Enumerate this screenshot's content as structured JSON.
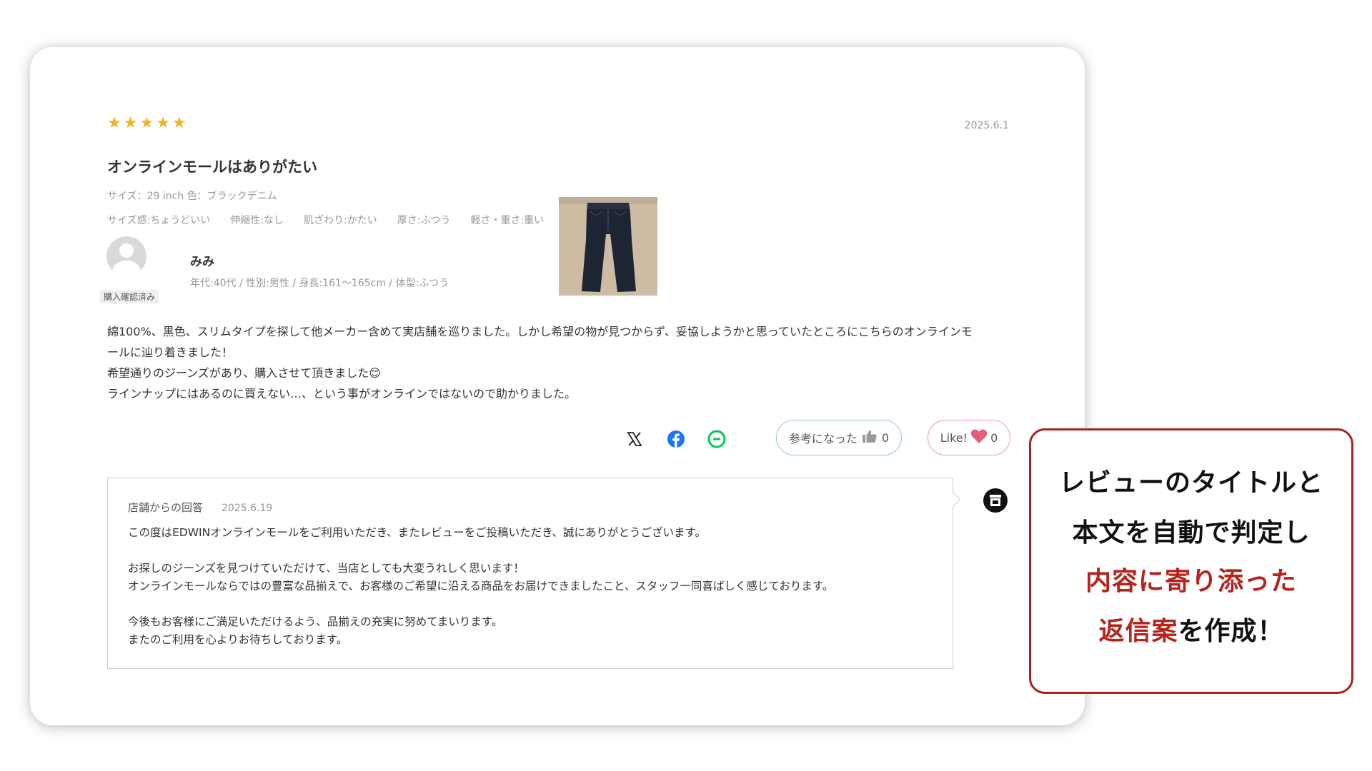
{
  "review": {
    "rating": 5,
    "date": "2025.6.1",
    "title": "オンラインモールはありがたい",
    "meta": "サイズ：29 inch 色：ブラックデニム",
    "attributes": [
      "サイズ感:ちょうどいい",
      "伸縮性:なし",
      "肌ざわり:かたい",
      "厚さ:ふつう",
      "軽さ・重さ:重い"
    ],
    "reviewer": {
      "name": "みみ",
      "info": "年代:40代 / 性別:男性 / 身長:161〜165cm / 体型:ふつう",
      "badge": "購入確認済み"
    },
    "body": [
      "綿100%、黒色、スリムタイプを探して他メーカー含めて実店舗を巡りました。しかし希望の物が見つからず、妥協しようかと思っていたところにこちらのオンラインモ",
      "ールに辿り着きました！",
      "希望通りのジーンズがあり、購入させて頂きました😊",
      "ラインナップにはあるのに買えない…、という事がオンラインではないので助かりました。"
    ],
    "share_icons": [
      "x-icon",
      "facebook-icon",
      "line-icon"
    ],
    "helpful": {
      "label": "参考になった",
      "count": "0"
    },
    "like": {
      "label": "Like!",
      "count": "0"
    }
  },
  "reply": {
    "label": "店舗からの回答",
    "date": "2025.6.19",
    "paragraphs": [
      [
        "この度はEDWINオンラインモールをご利用いただき、またレビューをご投稿いただき、誠にありがとうございます。"
      ],
      [
        "お探しのジーンズを見つけていただけて、当店としても大変うれしく思います！",
        "オンラインモールならではの豊富な品揃えで、お客様のご希望に沿える商品をお届けできましたこと、スタッフ一同喜ばしく感じております。"
      ],
      [
        "今後もお客様にご満足いただけるよう、品揃えの充実に努めてまいります。",
        "またのご利用を心よりお待ちしております。"
      ]
    ]
  },
  "callout": {
    "line1": "レビューのタイトルと",
    "line2": "本文を自動で判定し",
    "line3_highlight": "内容に寄り添った",
    "line4_highlight": "返信案",
    "line4_rest": "を作成！"
  },
  "colors": {
    "star": "#f0b429",
    "helpful_border": "#8ccdb9",
    "like_border": "#e89aa6",
    "heart": "#e0607a",
    "callout_border": "#a8231b",
    "callout_highlight": "#b5231b"
  }
}
